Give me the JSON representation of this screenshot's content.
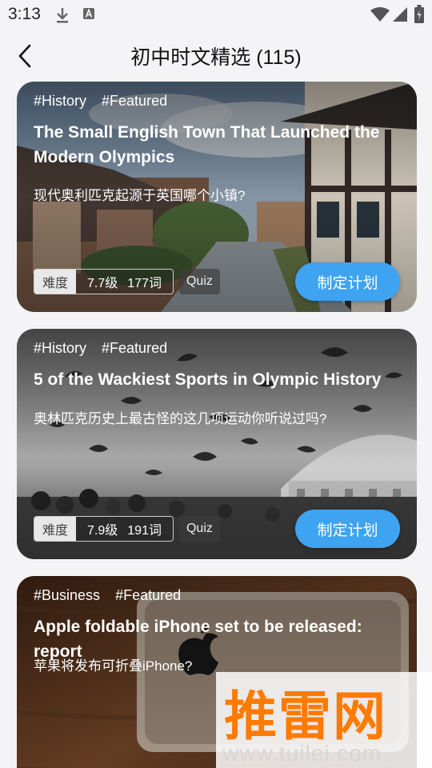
{
  "status_bar": {
    "time": "3:13"
  },
  "header": {
    "title": "初中时文精选 (115)"
  },
  "cards": [
    {
      "tags": [
        "#History",
        "#Featured"
      ],
      "title": "The Small English Town That Launched the Modern Olympics",
      "subtitle": "现代奥利匹克起源于英国哪个小镇?",
      "difficulty_label": "难度",
      "level": "7.7级",
      "words": "177词",
      "quiz": "Quiz",
      "plan_button": "制定计划"
    },
    {
      "tags": [
        "#History",
        "#Featured"
      ],
      "title": "5 of the Wackiest Sports in Olympic History",
      "subtitle": "奥林匹克历史上最古怪的这几项运动你听说过吗?",
      "difficulty_label": "难度",
      "level": "7.9级",
      "words": "191词",
      "quiz": "Quiz",
      "plan_button": "制定计划"
    },
    {
      "tags": [
        "#Business",
        "#Featured"
      ],
      "title": "Apple foldable iPhone set to be released: report",
      "subtitle": "苹果将发布可折叠iPhone?"
    }
  ],
  "watermark": {
    "text": "推雷网",
    "url": "www.tuilei.com"
  },
  "colors": {
    "accent": "#3ea3f0",
    "watermark": "#ff7a00"
  }
}
